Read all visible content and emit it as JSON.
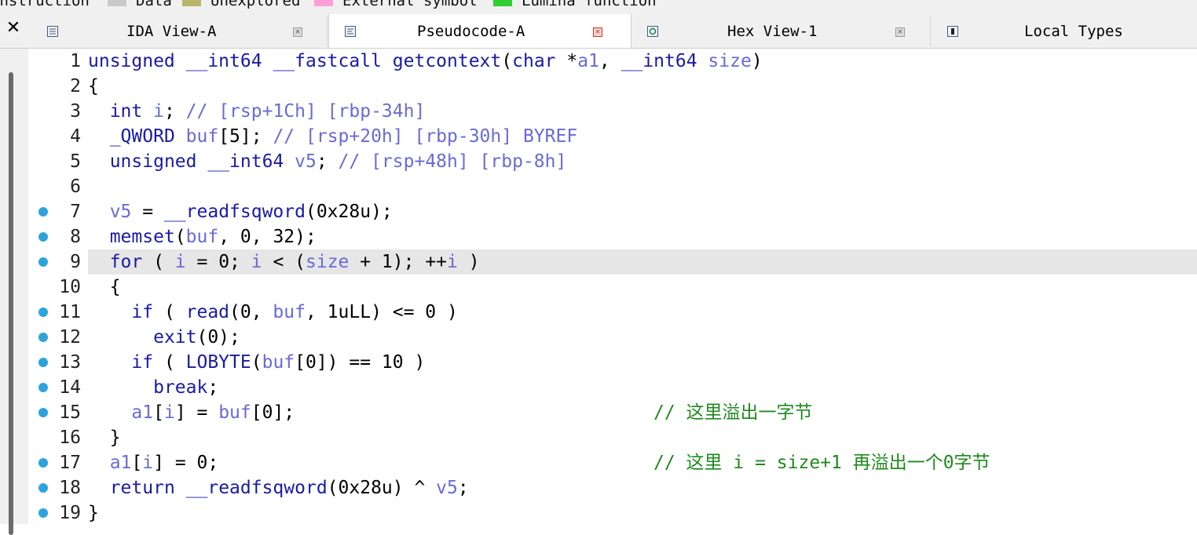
{
  "legend": [
    {
      "label": "Instruction",
      "color": "#c8c8c8"
    },
    {
      "label": "Data",
      "color": "#c8c8c8"
    },
    {
      "label": "Unexplored",
      "color": "#b9b56a"
    },
    {
      "label": "External symbol",
      "color": "#ff9fd6"
    },
    {
      "label": "Lumina function",
      "color": "#2fcf2f"
    }
  ],
  "tabs": [
    {
      "label": "IDA View-A",
      "icon": "ida-view-icon",
      "active": false
    },
    {
      "label": "Pseudocode-A",
      "icon": "pseudocode-icon",
      "active": true
    },
    {
      "label": "Hex View-1",
      "icon": "hex-view-icon",
      "active": false
    },
    {
      "label": "Local Types",
      "icon": "local-types-icon",
      "active": false
    }
  ],
  "highlight_line": 9,
  "lines": [
    {
      "n": "1",
      "bp": false,
      "code": "unsigned __int64 __fastcall getcontext(char *a1, __int64 size)",
      "comment": ""
    },
    {
      "n": "2",
      "bp": false,
      "code": "{",
      "comment": ""
    },
    {
      "n": "3",
      "bp": false,
      "code": "  int i; // [rsp+1Ch] [rbp-34h]",
      "comment": ""
    },
    {
      "n": "4",
      "bp": false,
      "code": "  _QWORD buf[5]; // [rsp+20h] [rbp-30h] BYREF",
      "comment": ""
    },
    {
      "n": "5",
      "bp": false,
      "code": "  unsigned __int64 v5; // [rsp+48h] [rbp-8h]",
      "comment": ""
    },
    {
      "n": "6",
      "bp": false,
      "code": "",
      "comment": ""
    },
    {
      "n": "7",
      "bp": true,
      "code": "  v5 = __readfsqword(0x28u);",
      "comment": ""
    },
    {
      "n": "8",
      "bp": true,
      "code": "  memset(buf, 0, 32);",
      "comment": ""
    },
    {
      "n": "9",
      "bp": true,
      "code": "  for ( i = 0; i < (size + 1); ++i )",
      "comment": ""
    },
    {
      "n": "10",
      "bp": false,
      "code": "  {",
      "comment": ""
    },
    {
      "n": "11",
      "bp": true,
      "code": "    if ( read(0, buf, 1uLL) <= 0 )",
      "comment": ""
    },
    {
      "n": "12",
      "bp": true,
      "code": "      exit(0);",
      "comment": ""
    },
    {
      "n": "13",
      "bp": true,
      "code": "    if ( LOBYTE(buf[0]) == 10 )",
      "comment": ""
    },
    {
      "n": "14",
      "bp": true,
      "code": "      break;",
      "comment": ""
    },
    {
      "n": "15",
      "bp": true,
      "code": "    a1[i] = buf[0];",
      "comment": "// 这里溢出一字节"
    },
    {
      "n": "16",
      "bp": false,
      "code": "  }",
      "comment": ""
    },
    {
      "n": "17",
      "bp": true,
      "code": "  a1[i] = 0;",
      "comment": "// 这里 i = size+1 再溢出一个0字节"
    },
    {
      "n": "18",
      "bp": true,
      "code": "  return __readfsqword(0x28u) ^ v5;",
      "comment": ""
    },
    {
      "n": "19",
      "bp": true,
      "code": "}",
      "comment": ""
    }
  ]
}
